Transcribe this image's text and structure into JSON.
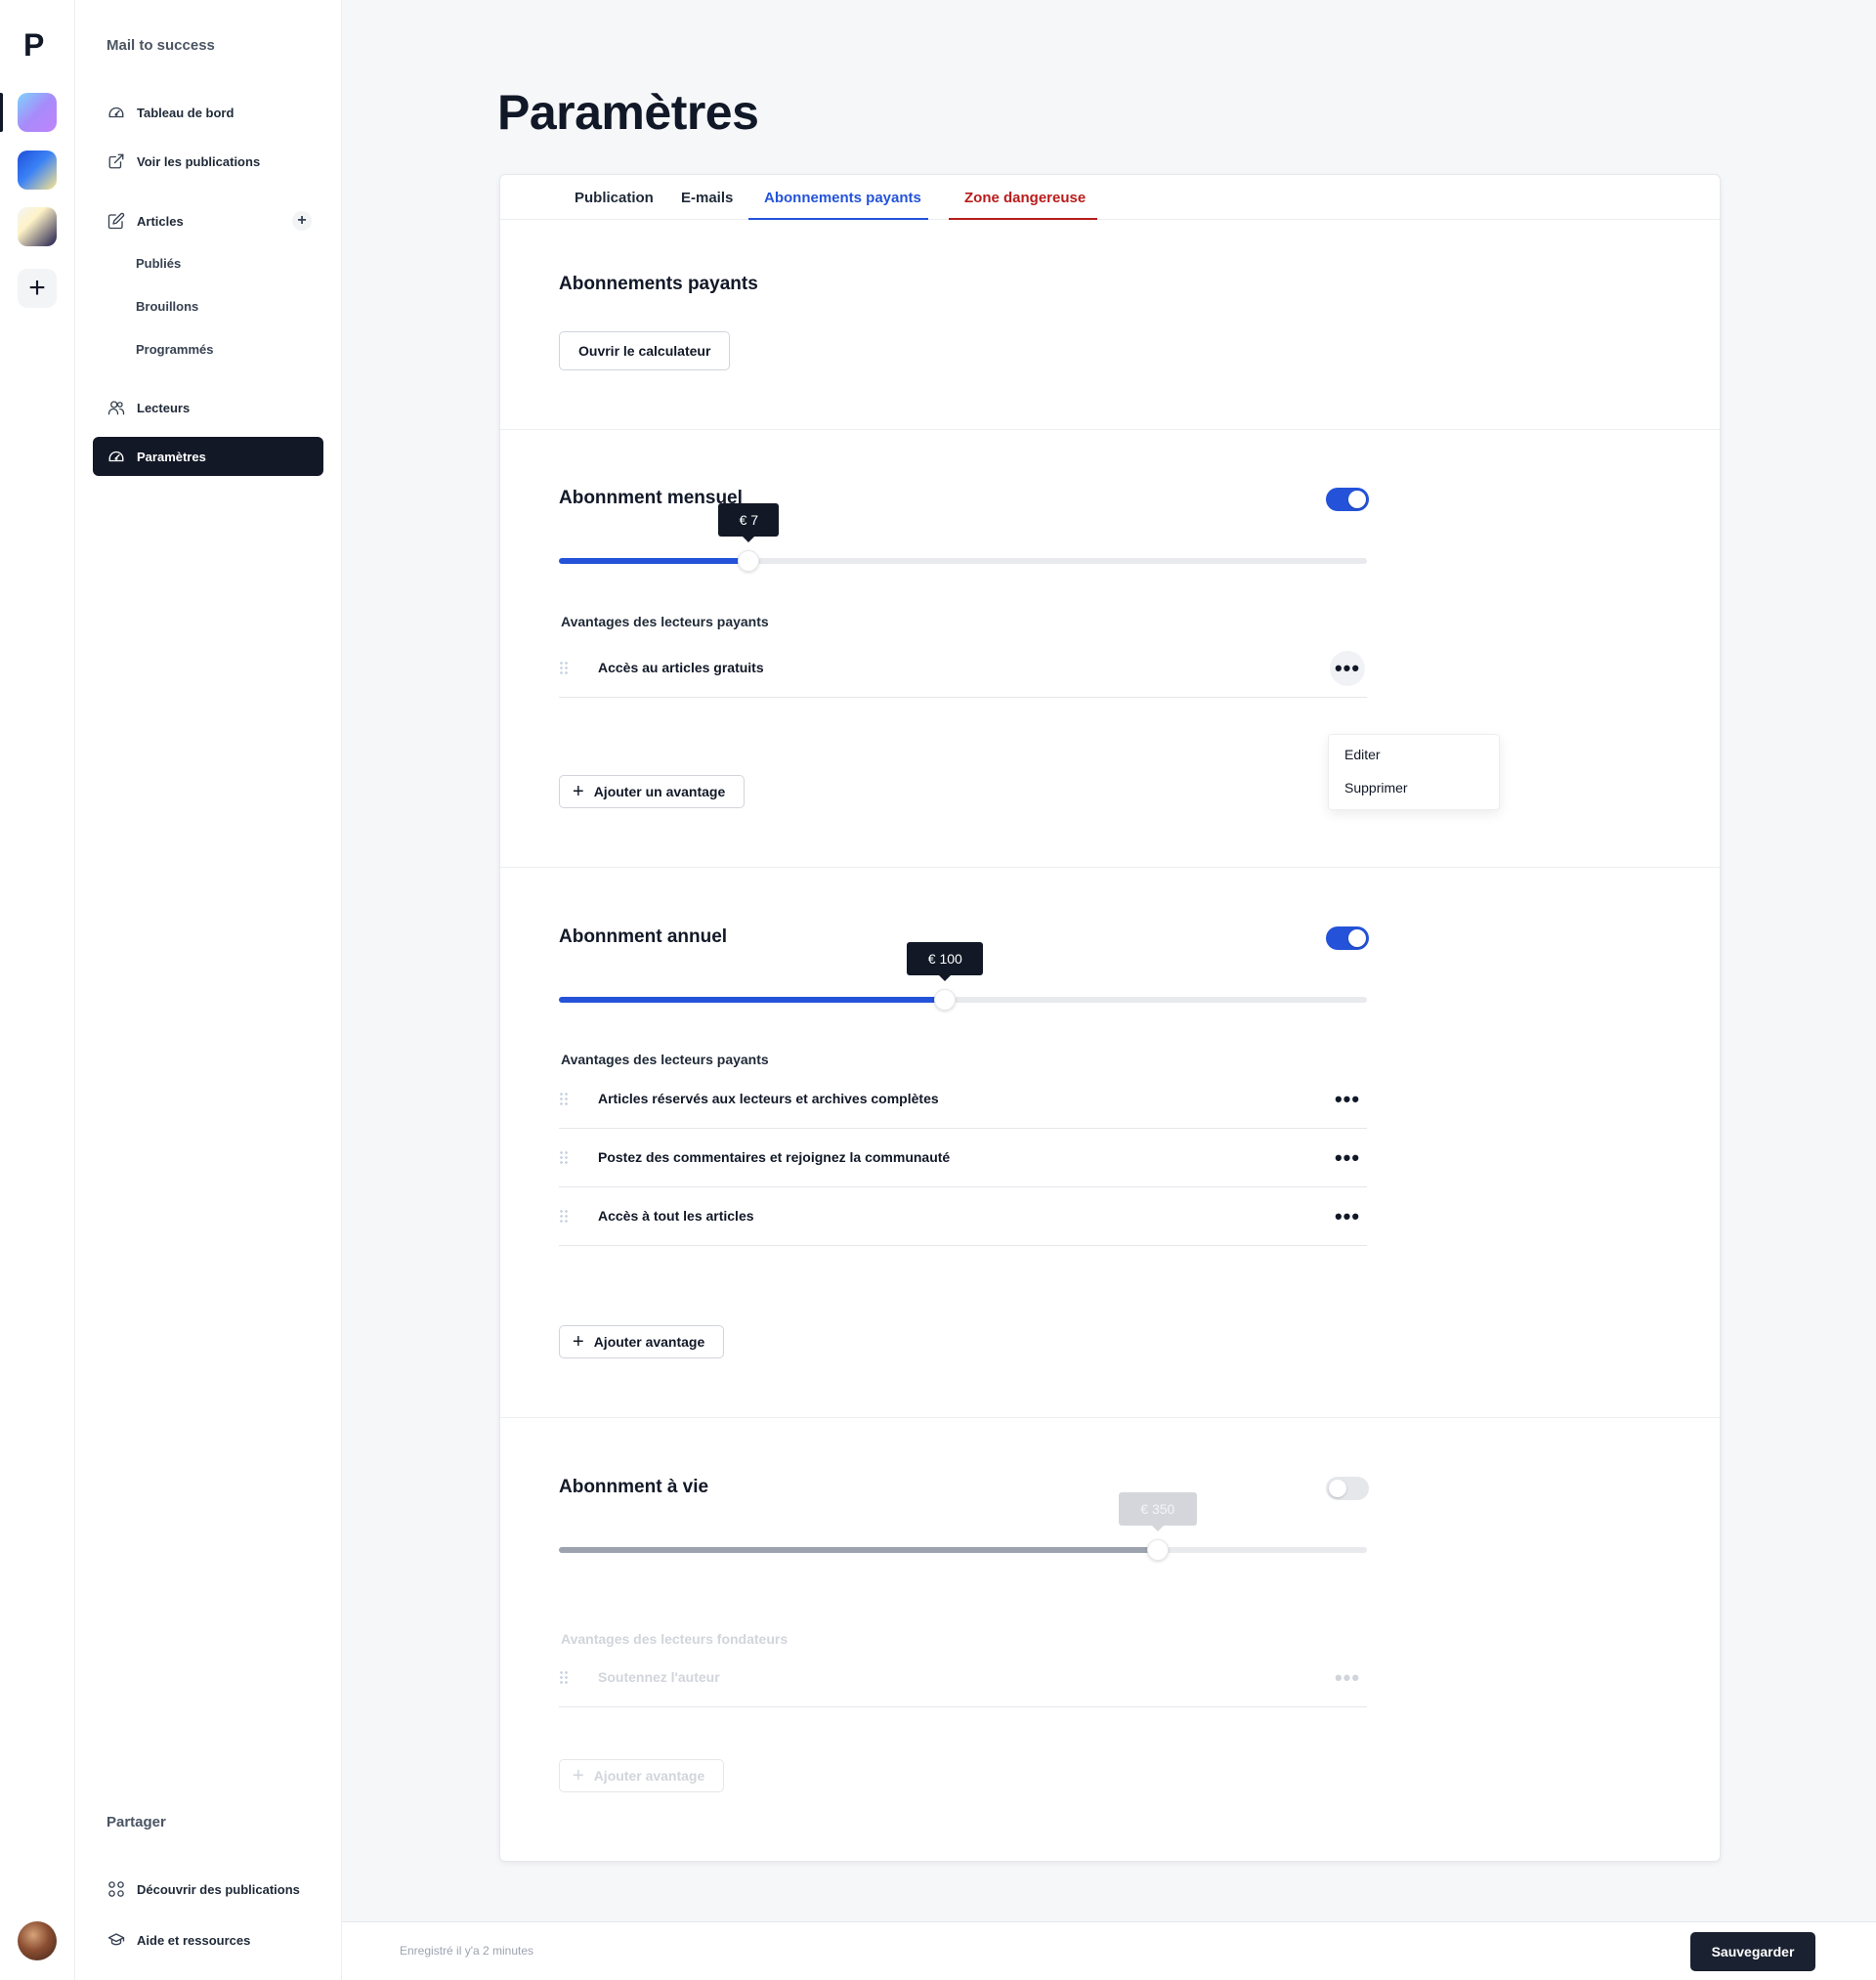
{
  "rail": {
    "logo": "P",
    "add_workspace": "+"
  },
  "sidebar": {
    "brand": "Mail to success",
    "items": [
      {
        "label": "Tableau de bord",
        "icon": "dashboard-gauge-icon"
      },
      {
        "label": "Voir les publications",
        "icon": "external-link-icon"
      },
      {
        "label": "Articles",
        "icon": "edit-icon"
      },
      {
        "label": "Lecteurs",
        "icon": "users-icon"
      },
      {
        "label": "Paramètres",
        "icon": "settings-gauge-icon"
      }
    ],
    "articles_add": "+",
    "subitems": [
      "Publiés",
      "Brouillons",
      "Programmés"
    ],
    "share_heading": "Partager",
    "bottom_items": [
      {
        "label": "Découvrir des publications",
        "icon": "grid-circles-icon"
      },
      {
        "label": "Aide et ressources",
        "icon": "graduation-cap-icon"
      }
    ]
  },
  "page": {
    "title": "Paramètres"
  },
  "tabs": [
    {
      "label": "Publication"
    },
    {
      "label": "E-mails"
    },
    {
      "label": "Abonnements payants",
      "active": true
    },
    {
      "label": "Zone dangereuse"
    }
  ],
  "colors": {
    "accent": "#2453d9",
    "danger": "#b91c1c",
    "dark": "#121826",
    "muted_fill": "#9ca3af"
  },
  "paid": {
    "heading": "Abonnements payants",
    "calculator_button": "Ouvrir le calculateur"
  },
  "monthly": {
    "heading": "Abonnment mensuel",
    "enabled": true,
    "price_label": "€ 7",
    "price_fraction": 0.235,
    "benefits_heading": "Avantages des lecteurs payants",
    "benefits": [
      "Accès au articles gratuits"
    ],
    "add_button": "Ajouter un avantage",
    "menu": [
      "Editer",
      "Supprimer"
    ]
  },
  "annual": {
    "heading": "Abonnment annuel",
    "enabled": true,
    "price_label": "€ 100",
    "price_fraction": 0.478,
    "benefits_heading": "Avantages des lecteurs payants",
    "benefits": [
      "Articles réservés aux lecteurs et archives complètes",
      "Postez des commentaires et rejoignez la communauté",
      "Accès à tout les articles"
    ],
    "add_button": "Ajouter avantage"
  },
  "lifetime": {
    "heading": "Abonnment à vie",
    "enabled": false,
    "price_label": "€ 350",
    "price_fraction": 0.741,
    "benefits_heading": "Avantages des lecteurs fondateurs",
    "benefits": [
      "Soutennez l'auteur"
    ],
    "add_button": "Ajouter avantage"
  },
  "more_glyph": "•••",
  "footer": {
    "saved_status": "Enregistré il y'a 2 minutes",
    "save_button": "Sauvegarder"
  }
}
